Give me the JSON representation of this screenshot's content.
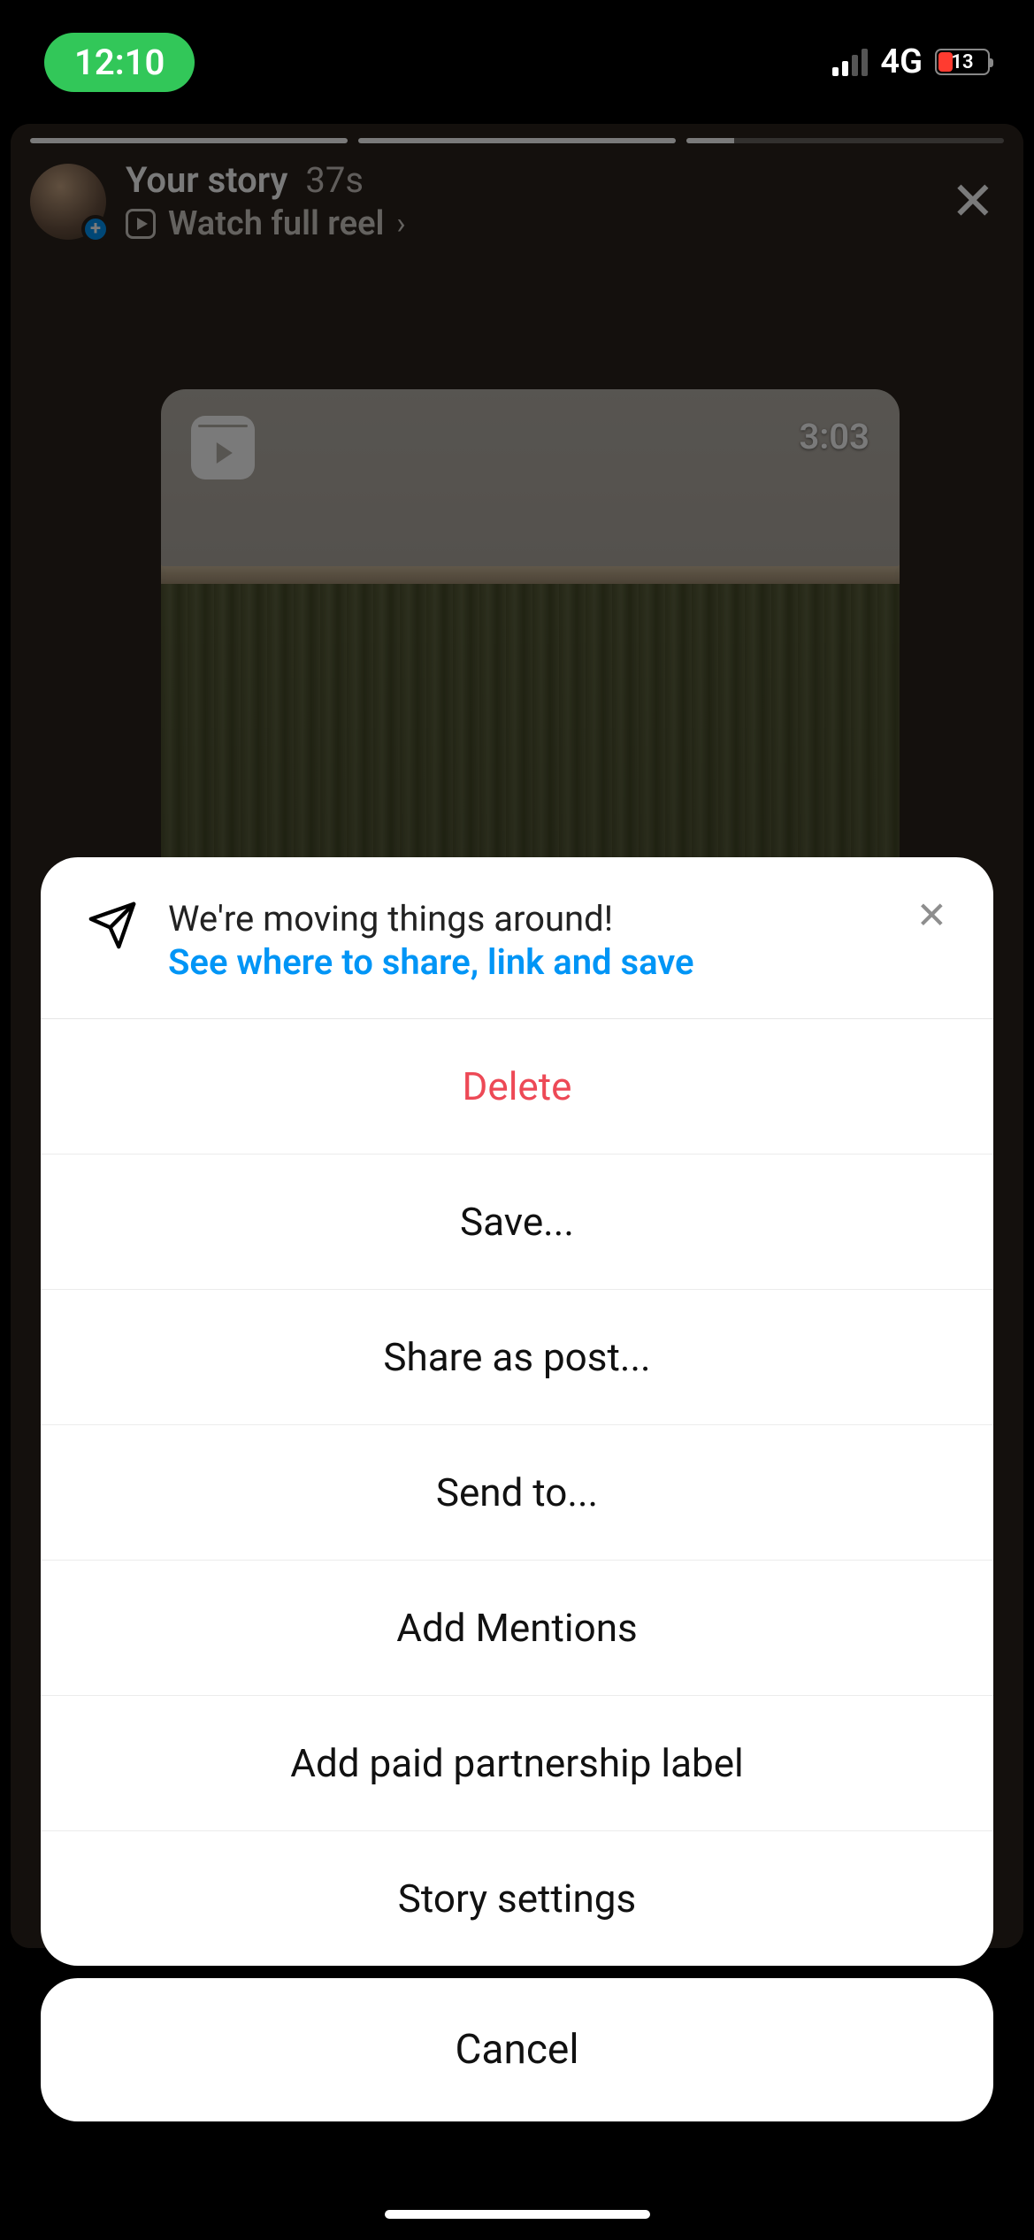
{
  "status_bar": {
    "time": "12:10",
    "network": "4G",
    "battery_percent": "13"
  },
  "story": {
    "title": "Your story",
    "age": "37s",
    "watch_label": "Watch full reel",
    "reel_duration": "3:03"
  },
  "sheet": {
    "banner_line1": "We're moving things around!",
    "banner_link": "See where to share, link and save",
    "items": [
      {
        "label": "Delete",
        "destructive": true
      },
      {
        "label": "Save..."
      },
      {
        "label": "Share as post..."
      },
      {
        "label": "Send to..."
      },
      {
        "label": "Add Mentions"
      },
      {
        "label": "Add paid partnership label"
      },
      {
        "label": "Story settings"
      }
    ],
    "cancel": "Cancel"
  }
}
